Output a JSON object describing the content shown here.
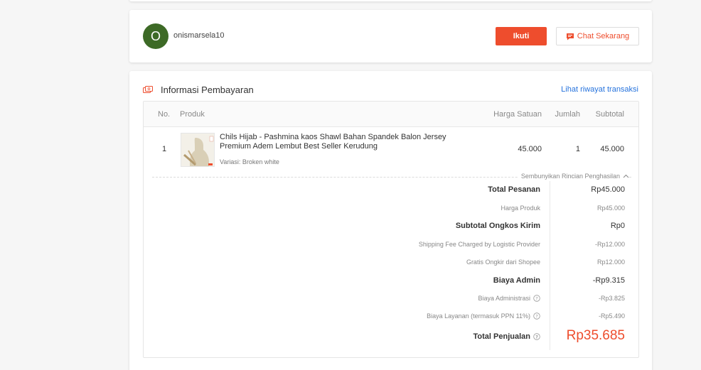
{
  "buyer": {
    "avatar_letter": "O",
    "username": "onismarsela10",
    "follow_label": "Ikuti",
    "chat_label": "Chat Sekarang"
  },
  "payment": {
    "title": "Informasi Pembayaran",
    "history_link": "Lihat riwayat transaksi",
    "columns": [
      "No.",
      "Produk",
      "Harga Satuan",
      "Jumlah",
      "Subtotal"
    ],
    "items": [
      {
        "no": "1",
        "name": "Chils Hijab - Pashmina kaos Shawl Bahan Spandek Balon Jersey Premium Adem Lembut Best Seller Kerudung",
        "variant": "Variasi: Broken white",
        "unit_price": "45.000",
        "qty": "1",
        "subtotal": "45.000"
      }
    ],
    "toggle_label": "Sembunyikan Rincian Penghasilan",
    "breakdown": {
      "total_pesanan_label": "Total Pesanan",
      "total_pesanan": "Rp45.000",
      "harga_produk_label": "Harga Produk",
      "harga_produk": "Rp45.000",
      "subtotal_ongkir_label": "Subtotal Ongkos Kirim",
      "subtotal_ongkir": "Rp0",
      "shipping_fee_label": "Shipping Fee Charged by Logistic Provider",
      "shipping_fee": "-Rp12.000",
      "gratis_ongkir_label": "Gratis Ongkir dari Shopee",
      "gratis_ongkir": "Rp12.000",
      "biaya_admin_label": "Biaya Admin",
      "biaya_admin": "-Rp9.315",
      "biaya_administrasi_label": "Biaya Administrasi",
      "biaya_administrasi": "-Rp3.825",
      "biaya_layanan_label": "Biaya Layanan (termasuk PPN 11%)",
      "biaya_layanan": "-Rp5.490",
      "total_penjualan_label": "Total Penjualan",
      "total_penjualan": "Rp35.685"
    }
  },
  "colors": {
    "accent": "#ee4d2d",
    "link": "#2673dd",
    "avatar_bg": "#3d6a26"
  }
}
